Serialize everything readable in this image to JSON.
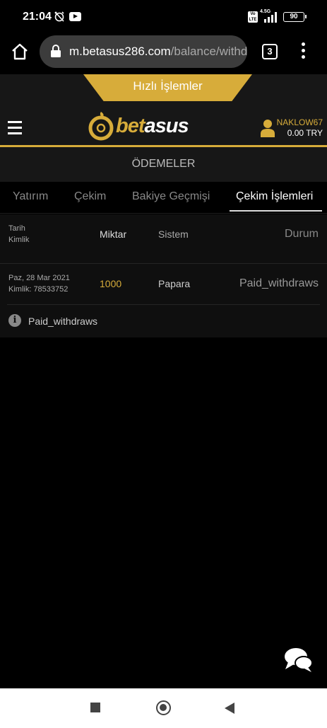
{
  "status_bar": {
    "time": "21:04",
    "network": "4.5G",
    "volte": "Vo LTE",
    "battery": "90",
    "icons": [
      "alarm-off-icon",
      "youtube-icon",
      "signal-icon",
      "battery-icon"
    ]
  },
  "browser": {
    "url_domain": "m.betasus286.com",
    "url_path": "/balance/withdı",
    "tab_count": "3",
    "icons": [
      "home-icon",
      "lock-icon",
      "tabs-icon",
      "more-vert-icon"
    ]
  },
  "header": {
    "quick_actions_label": "Hızlı İşlemler",
    "logo_part1": "bet",
    "logo_part2": "asus",
    "username": "NAKLOW67",
    "balance": "0.00 TRY"
  },
  "page": {
    "title": "ÖDEMELER"
  },
  "tabs": [
    {
      "label": "Yatırım",
      "active": false
    },
    {
      "label": "Çekim",
      "active": false
    },
    {
      "label": "Bakiye Geçmişi",
      "active": false
    },
    {
      "label": "Çekim İşlemleri",
      "active": true
    }
  ],
  "table": {
    "headers": {
      "date": "Tarih",
      "id": "Kimlik",
      "amount": "Miktar",
      "system": "Sistem",
      "status": "Durum"
    },
    "rows": [
      {
        "date": "Paz, 28 Mar 2021",
        "id": "Kimlik: 78533752",
        "amount": "1000",
        "system": "Papara",
        "status": "Paid_withdraws"
      }
    ],
    "note": "Paid_withdraws"
  },
  "colors": {
    "accent": "#d7ac3a",
    "background": "#000000",
    "panel": "#171717"
  }
}
